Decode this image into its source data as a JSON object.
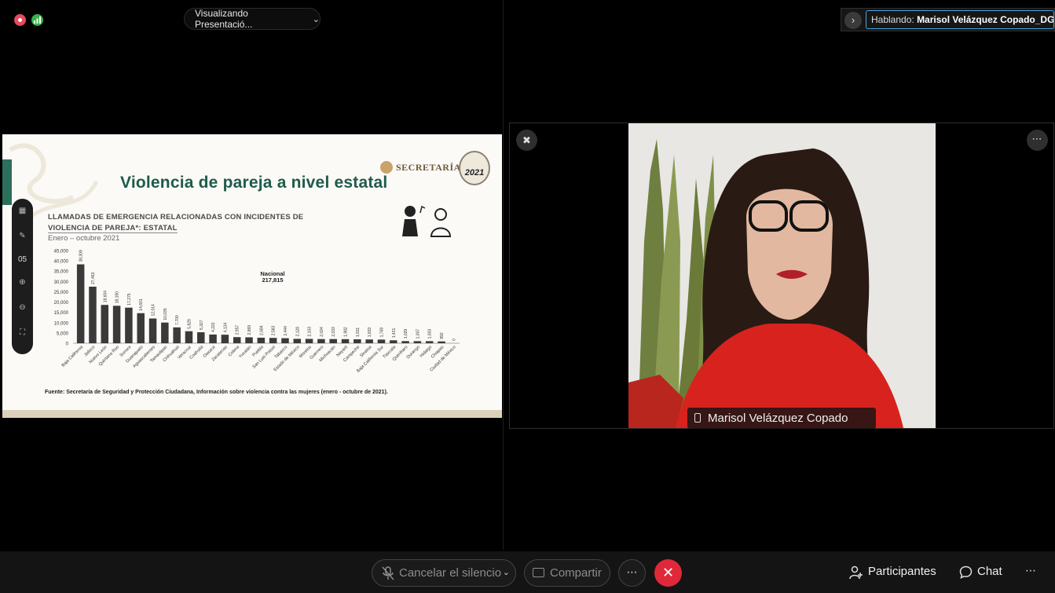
{
  "header": {
    "view_label": "Visualizando Presentació...",
    "speaking_prefix": "Hablando:",
    "speaking_name": "Marisol Velázquez Copado_DG..."
  },
  "slide": {
    "title": "Violencia de pareja a nivel estatal",
    "logo_text": "SECRETARÍA",
    "logo_year": "2021",
    "subtitle_line1": "LLAMADAS DE EMERGENCIA RELACIONADAS CON INCIDENTES DE",
    "subtitle_line2": "VIOLENCIA DE PAREJA*: ESTATAL",
    "period": "Enero – octubre 2021",
    "source": "Fuente: Secretaría de Seguridad y Protección Ciudadana, Información sobre violencia contra las mujeres (enero - octubre de 2021).",
    "toolbar": {
      "page": "05"
    }
  },
  "chart_data": {
    "type": "bar",
    "title": "LLAMADAS DE EMERGENCIA RELACIONADAS CON INCIDENTES DE VIOLENCIA DE PAREJA*: ESTATAL",
    "annotation": {
      "label": "Nacional",
      "value": "217,815"
    },
    "ylim": [
      0,
      45000
    ],
    "yticks": [
      "45,000",
      "40,000",
      "35,000",
      "30,000",
      "25,000",
      "20,000",
      "15,000",
      "10,000",
      "5,000",
      "0"
    ],
    "categories": [
      "Baja California",
      "Jalisco",
      "Nuevo León",
      "Quintana Roo",
      "Sonora",
      "Guanajuato",
      "Aguascalientes",
      "Tamaulipas",
      "Chihuahua",
      "Veracruz",
      "Coahuila",
      "Oaxaca",
      "Zacatecas",
      "Colima",
      "Yucatán",
      "Puebla",
      "San Luis Potosí",
      "Tabasco",
      "Estado de México",
      "Morelos",
      "Guerrero",
      "Michoacán",
      "Nayarit",
      "Campeche",
      "Sinaloa",
      "Baja California Sur",
      "Tlaxcala",
      "Querétaro",
      "Durango",
      "Hidalgo",
      "Chiapas",
      "Ciudad de México"
    ],
    "values": [
      38309,
      27463,
      18604,
      18190,
      17275,
      14601,
      12014,
      10035,
      7700,
      5829,
      5327,
      4222,
      4134,
      2957,
      2869,
      2684,
      2583,
      2444,
      2128,
      2103,
      2024,
      2033,
      1982,
      1911,
      1833,
      1769,
      1421,
      1029,
      1007,
      1003,
      892,
      0
    ],
    "value_labels": [
      "38,309",
      "27,463",
      "18,604",
      "18,190",
      "17,275",
      "14,601",
      "12,014",
      "10,035",
      "7,700",
      "5,829",
      "5,327",
      "4,222",
      "4,134",
      "2,957",
      "2,869",
      "2,684",
      "2,583",
      "2,444",
      "2,128",
      "2,103",
      "2,024",
      "2,033",
      "1,982",
      "1,911",
      "1,833",
      "1,769",
      "1,421",
      "1,029",
      "1,007",
      "1,003",
      "892",
      "0"
    ]
  },
  "video": {
    "participant_name": "Marisol Velázquez Copado"
  },
  "controls": {
    "mute_label": "Cancelar el silencio",
    "share_label": "Compartir",
    "participants_label": "Participantes",
    "chat_label": "Chat"
  },
  "colors": {
    "slide_title": "#1f5b4b",
    "bar": "#3a3a3a",
    "end_call": "#e0283b",
    "speaking_border": "#4aa3df"
  }
}
